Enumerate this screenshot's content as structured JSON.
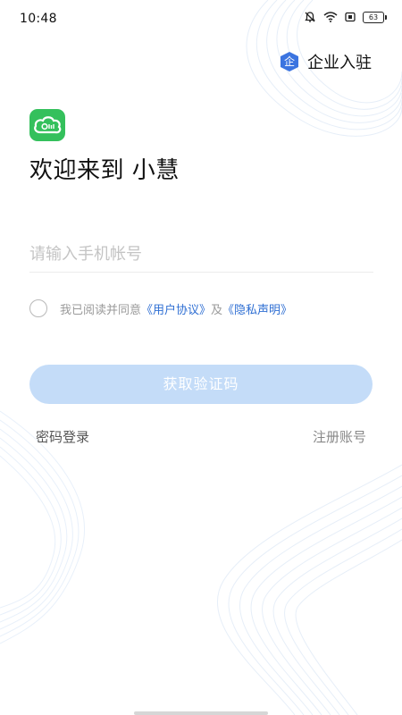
{
  "status_bar": {
    "time": "10:48",
    "battery": "63"
  },
  "header": {
    "enterprise_badge": "企",
    "enterprise_label": "企业入驻"
  },
  "welcome": {
    "title": "欢迎来到 小慧"
  },
  "login_form": {
    "phone_placeholder": "请输入手机帐号",
    "phone_value": "",
    "agree_checked": false,
    "agree_prefix": "我已阅读并同意",
    "user_agreement": "《用户协议》",
    "agree_conj": "及",
    "privacy_policy": "《隐私声明》",
    "get_code_label": "获取验证码"
  },
  "footer_links": {
    "password_login": "密码登录",
    "register": "注册账号"
  },
  "colors": {
    "brand_green": "#34c05c",
    "link_blue": "#2f6fd3",
    "button_disabled": "#c4dcf8",
    "badge_blue": "#3b74e0"
  }
}
